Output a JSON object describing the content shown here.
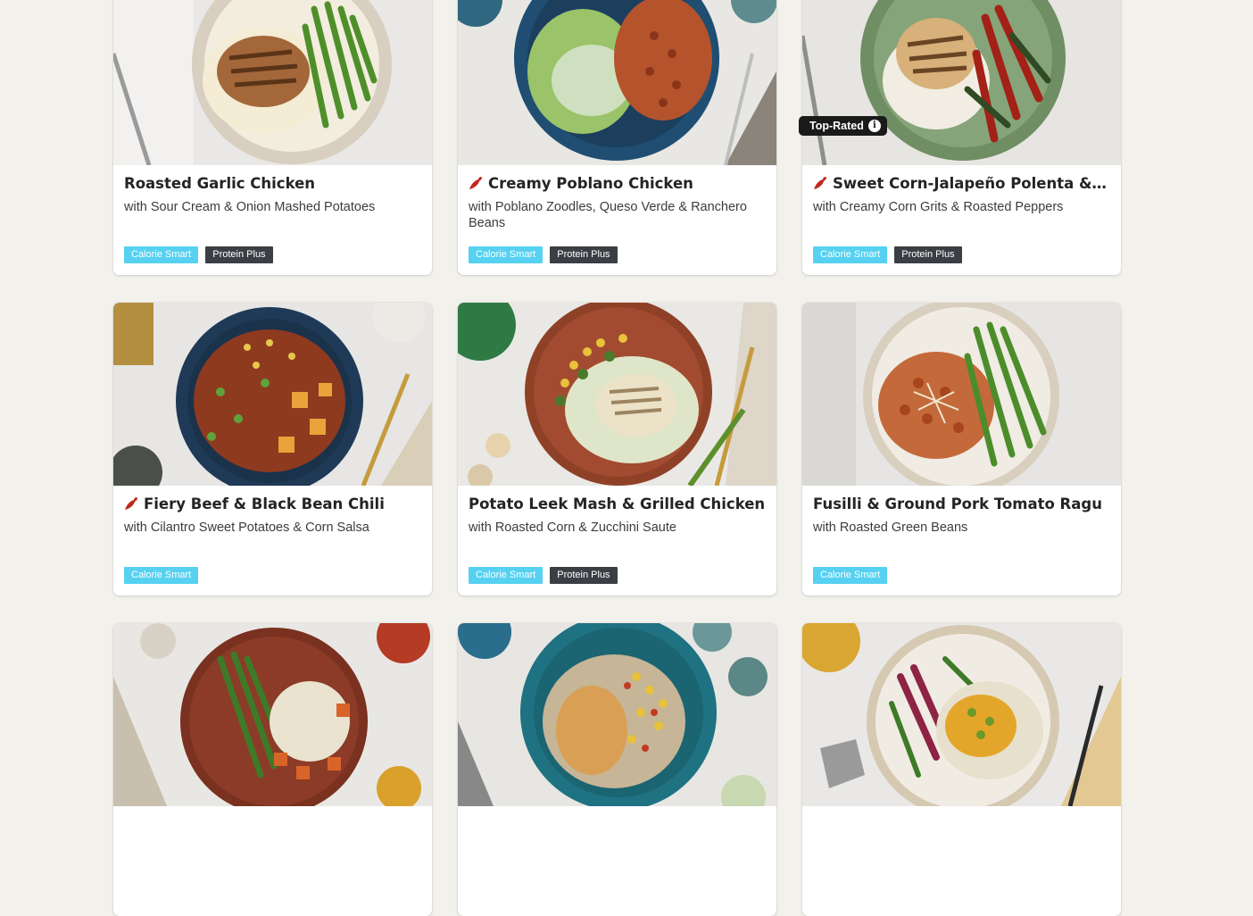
{
  "recipes": [
    {
      "title": "Roasted Garlic Chicken",
      "subtitle": "with Sour Cream & Onion Mashed Potatoes",
      "spicy": false,
      "tags": [
        "Calorie Smart",
        "Protein Plus"
      ]
    },
    {
      "title": "Creamy Poblano Chicken",
      "subtitle": "with Poblano Zoodles, Queso Verde & Ranchero Beans",
      "spicy": true,
      "tags": [
        "Calorie Smart",
        "Protein Plus"
      ]
    },
    {
      "title": "Sweet Corn-Jalapeño Polenta & C...",
      "subtitle": "with Creamy Corn Grits & Roasted Peppers",
      "spicy": true,
      "badge": "Top-Rated",
      "tags": [
        "Calorie Smart",
        "Protein Plus"
      ]
    },
    {
      "title": "Fiery Beef & Black Bean Chili",
      "subtitle": "with Cilantro Sweet Potatoes & Corn Salsa",
      "spicy": true,
      "tags": [
        "Calorie Smart"
      ]
    },
    {
      "title": "Potato Leek Mash & Grilled Chicken",
      "subtitle": "with Roasted Corn & Zucchini Saute",
      "spicy": false,
      "tags": [
        "Calorie Smart",
        "Protein Plus"
      ]
    },
    {
      "title": "Fusilli & Ground Pork Tomato Ragu",
      "subtitle": "with Roasted Green Beans",
      "spicy": false,
      "tags": [
        "Calorie Smart"
      ]
    },
    {
      "title": "",
      "subtitle": "",
      "spicy": false,
      "tags": []
    },
    {
      "title": "",
      "subtitle": "",
      "spicy": false,
      "tags": []
    },
    {
      "title": "",
      "subtitle": "",
      "spicy": false,
      "tags": []
    }
  ],
  "colors": {
    "background": "#f3f1ec",
    "calorie_tag": "#56d1f1",
    "protein_tag": "#3b3f44",
    "badge": "#1a1a1a",
    "chili": "#c0281e"
  },
  "icons": {
    "spicy": "chili-pepper-icon",
    "info": "info-icon"
  }
}
